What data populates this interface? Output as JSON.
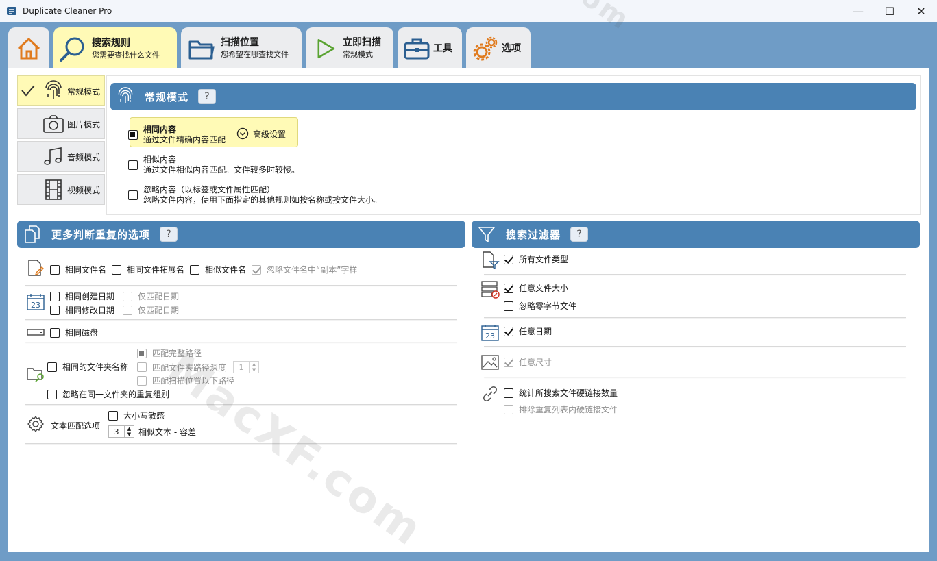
{
  "window": {
    "title": "Duplicate Cleaner Pro",
    "minimize": "—",
    "maximize": "☐",
    "close": "✕"
  },
  "tabs": [
    {
      "title": "",
      "subtitle": "",
      "icon": "home-icon"
    },
    {
      "title": "搜索规则",
      "subtitle": "您需要查找什么文件",
      "icon": "search-icon"
    },
    {
      "title": "扫描位置",
      "subtitle": "您希望在哪查找文件",
      "icon": "folder-icon"
    },
    {
      "title": "立即扫描",
      "subtitle": "常规模式",
      "icon": "play-icon"
    },
    {
      "title": "工具",
      "subtitle": "",
      "icon": "toolbox-icon"
    },
    {
      "title": "选项",
      "subtitle": "",
      "icon": "gears-icon"
    }
  ],
  "modes": [
    {
      "label": "常规模式",
      "icon": "fingerprint-icon",
      "active": true
    },
    {
      "label": "图片模式",
      "icon": "camera-icon",
      "active": false
    },
    {
      "label": "音频模式",
      "icon": "music-icon",
      "active": false
    },
    {
      "label": "视频模式",
      "icon": "film-icon",
      "active": false
    }
  ],
  "normal_mode": {
    "header": "常规模式",
    "help": "?",
    "options": [
      {
        "title": "相同内容",
        "desc": "通过文件精确内容匹配",
        "selected": true
      },
      {
        "title": "相似内容",
        "desc": "通过文件相似内容匹配。文件较多时较慢。",
        "selected": false
      },
      {
        "title": "忽略内容（以标签或文件属性匹配）",
        "desc": "忽略文件内容，使用下面指定的其他规则如按名称或按文件大小。",
        "selected": false
      }
    ],
    "advanced": "高级设置"
  },
  "more_options": {
    "header": "更多判断重复的选项",
    "help": "?",
    "same_filename": "相同文件名",
    "same_ext": "相同文件拓展名",
    "similar_filename": "相似文件名",
    "ignore_copy": "忽略文件名中“副本”字样",
    "same_created": "相同创建日期",
    "date_only_1": "仅匹配日期",
    "same_modified": "相同修改日期",
    "date_only_2": "仅匹配日期",
    "same_disk": "相同磁盘",
    "same_folder_name": "相同的文件夹名称",
    "match_full_path": "匹配完整路径",
    "match_folder_depth": "匹配文件夹路径深度",
    "folder_depth_value": "1",
    "match_below_scan": "匹配扫描位置以下路径",
    "ignore_same_folder": "忽略在同一文件夹的重复组别",
    "text_match": "文本匹配选项",
    "case_sensitive": "大小写敏感",
    "similar_text_value": "3",
    "similar_text": "相似文本 - 容差"
  },
  "filters": {
    "header": "搜索过滤器",
    "help": "?",
    "all_types": "所有文件类型",
    "any_size": "任意文件大小",
    "ignore_zero": "忽略零字节文件",
    "any_date": "任意日期",
    "any_dimension": "任意尺寸",
    "count_hardlinks": "统计所搜索文件硬链接数量",
    "exclude_hardlinks": "排除重复列表内硬链接文件"
  },
  "watermarks": [
    "MacXF.com",
    "com"
  ],
  "colors": {
    "frame": "#6f9cc6",
    "header": "#4a82b4",
    "active_tab": "#fffab6"
  }
}
